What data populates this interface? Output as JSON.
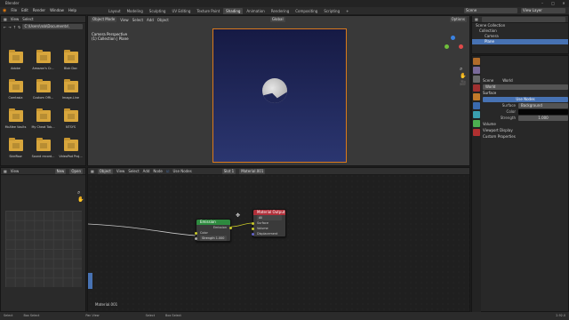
{
  "app": {
    "title": "Blender",
    "version": "2.92"
  },
  "menus": [
    "File",
    "Edit",
    "Render",
    "Window",
    "Help"
  ],
  "workspaces": [
    "Layout",
    "Modeling",
    "Sculpting",
    "UV Editing",
    "Texture Paint",
    "Shading",
    "Animation",
    "Rendering",
    "Compositing",
    "Scripting"
  ],
  "active_workspace": "Shading",
  "scene": {
    "label": "Scene",
    "view_layer": "View Layer"
  },
  "file_browser": {
    "view_label": "View",
    "select_label": "Select",
    "path": "C:\\Users\\rob\\Documents\\",
    "items": [
      "Adobe",
      "Amazon's Cr...",
      "Blok Doc",
      "Camtasia",
      "Custom Offi...",
      "Image-Line",
      "McAfee Vaults",
      "My Cheat Tab...",
      "NTSYS",
      "SkidRow",
      "Sound record...",
      "VideoPad Proj..."
    ]
  },
  "image_editor": {
    "view_label": "View",
    "new_label": "New",
    "open_label": "Open"
  },
  "viewport": {
    "mode": "Object Mode",
    "menu": [
      "View",
      "Select",
      "Add",
      "Object"
    ],
    "info_line1": "Camera Perspective",
    "info_line2": "(1) Collection | Plane",
    "transform": "Global",
    "options": "Options"
  },
  "outliner": {
    "root": "Scene Collection",
    "items": [
      "Collection",
      "Camera",
      "Plane"
    ]
  },
  "properties": {
    "scene_label": "Scene",
    "world_tab": "World",
    "world_name": "World",
    "section_surface": "Surface",
    "use_nodes_label": "Use Nodes",
    "surface_label": "Surface",
    "surface_value": "Background",
    "color_label": "Color",
    "strength_label": "Strength",
    "strength_value": "1.000",
    "section_volume": "Volume",
    "section_viewport": "Viewport Display",
    "section_custom": "Custom Properties"
  },
  "node_editor": {
    "object_mode": "Object",
    "menu": [
      "View",
      "Select",
      "Add",
      "Node"
    ],
    "use_nodes": "Use Nodes",
    "slot": "Slot 1",
    "material": "Material.001",
    "footer_material": "Material.001",
    "emission_node": {
      "title": "Emission",
      "output": "Emission",
      "color_label": "Color",
      "strength_label": "Strength",
      "strength_value": "1.000"
    },
    "output_node": {
      "title": "Material Output",
      "target": "All",
      "inputs": [
        "Surface",
        "Volume",
        "Displacement"
      ]
    }
  },
  "status": {
    "select": "Select",
    "box_select": "Box Select",
    "pan_view": "Pan View",
    "select2": "Select",
    "box_select2": "Box Select",
    "version": "2.92.0"
  },
  "colors": {
    "accent": "#4772b3",
    "folder": "#d8a63c",
    "emission_header": "#2e8a3f",
    "output_header": "#b0303a"
  }
}
